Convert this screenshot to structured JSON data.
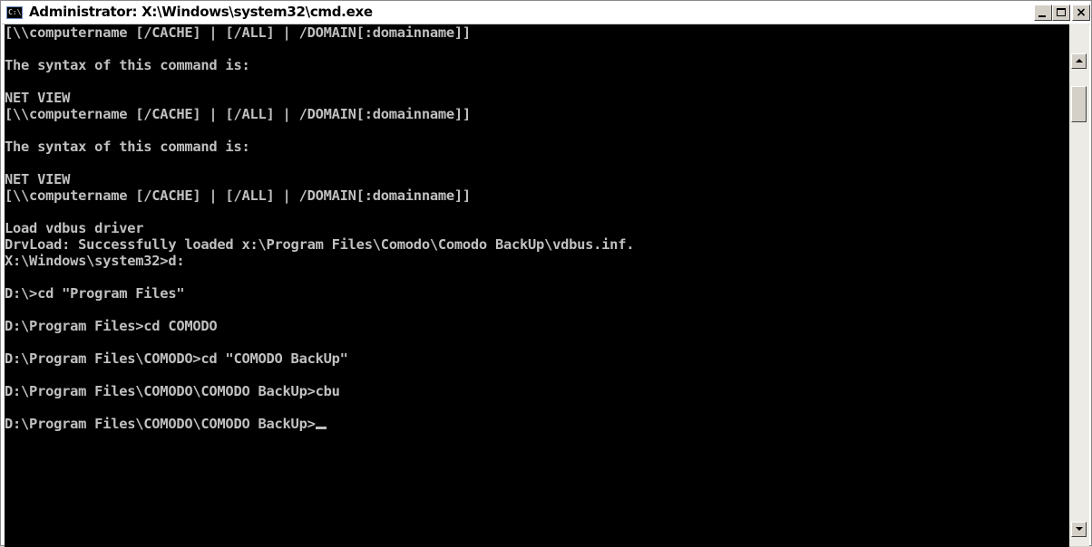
{
  "window": {
    "title": "Administrator: X:\\Windows\\system32\\cmd.exe",
    "icon": "cmd-icon",
    "icon_text": "C:\\.",
    "buttons": {
      "minimize": "minimize-icon",
      "maximize": "maximize-icon",
      "close_glyph": "×"
    }
  },
  "console": {
    "background": "#000000",
    "foreground": "#c0c0c0",
    "lines": [
      "[\\\\computername [/CACHE] | [/ALL] | /DOMAIN[:domainname]]",
      "",
      "The syntax of this command is:",
      "",
      "NET VIEW",
      "[\\\\computername [/CACHE] | [/ALL] | /DOMAIN[:domainname]]",
      "",
      "The syntax of this command is:",
      "",
      "NET VIEW",
      "[\\\\computername [/CACHE] | [/ALL] | /DOMAIN[:domainname]]",
      "",
      "Load vdbus driver",
      "DrvLoad: Successfully loaded x:\\Program Files\\Comodo\\Comodo BackUp\\vdbus.inf.",
      "X:\\Windows\\system32>d:",
      "",
      "D:\\>cd \"Program Files\"",
      "",
      "D:\\Program Files>cd COMODO",
      "",
      "D:\\Program Files\\COMODO>cd \"COMODO BackUp\"",
      "",
      "D:\\Program Files\\COMODO\\COMODO BackUp>cbu",
      "",
      "D:\\Program Files\\COMODO\\COMODO BackUp>"
    ]
  },
  "scrollbar": {
    "up_icon": "scroll-up-arrow-icon",
    "down_icon": "scroll-down-arrow-icon"
  }
}
